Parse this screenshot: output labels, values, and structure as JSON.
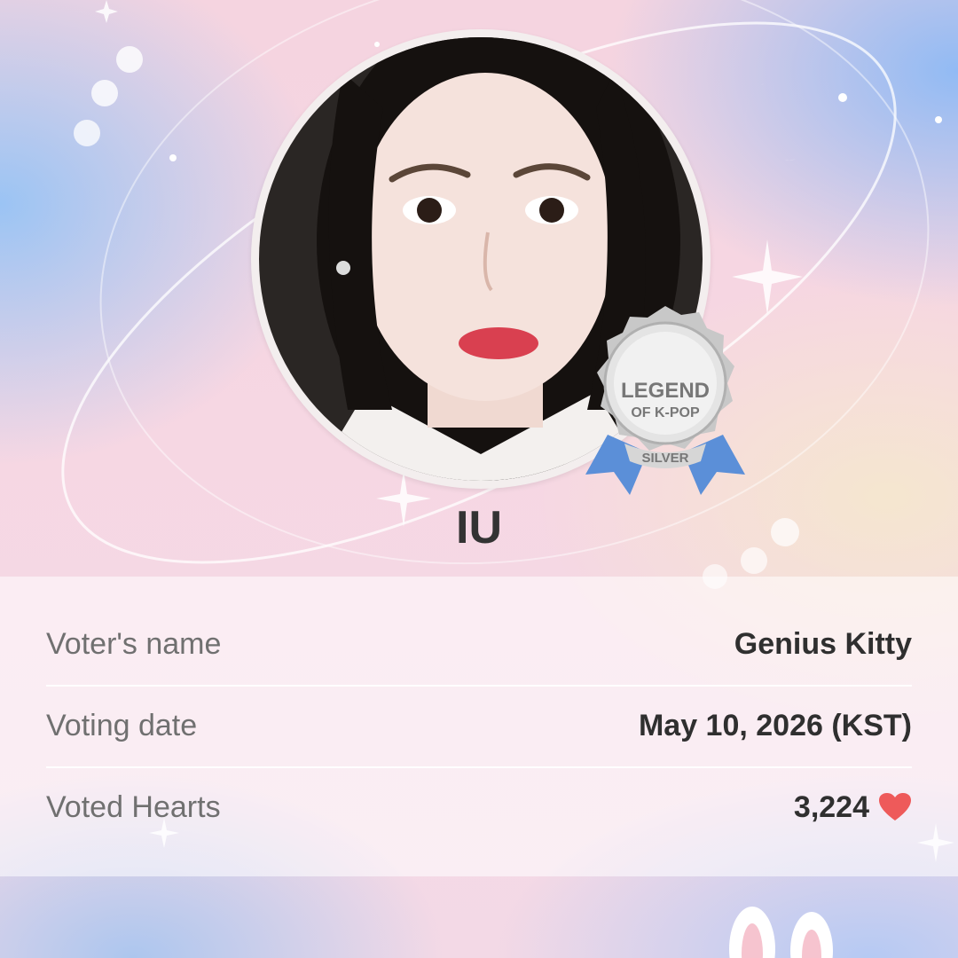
{
  "idol": {
    "name": "IU"
  },
  "badge": {
    "line1": "LEGEND",
    "line2": "OF K-POP",
    "tier": "SILVER"
  },
  "vote_info": {
    "rows": [
      {
        "label": "Voter's name",
        "value": "Genius Kitty"
      },
      {
        "label": "Voting date",
        "value": "May 10, 2026 (KST)"
      },
      {
        "label": "Voted Hearts",
        "value": "3,224"
      }
    ]
  },
  "colors": {
    "heart": "#ee5a5a",
    "badge_ribbon": "#5b8fd8",
    "badge_silver": "#c8c8c8"
  },
  "icons": [
    "moon-icon",
    "sparkle-icon",
    "heart-icon",
    "ribbon-badge-icon"
  ]
}
